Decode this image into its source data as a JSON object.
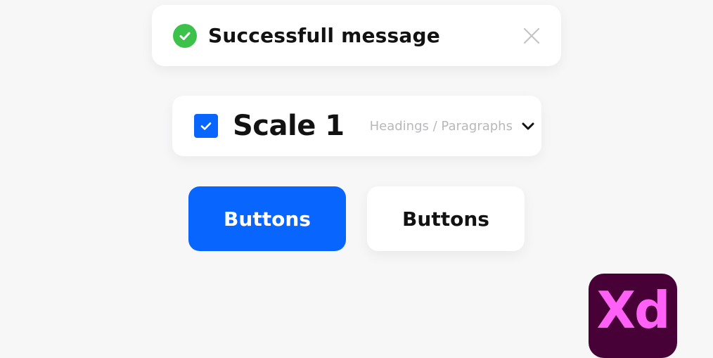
{
  "colors": {
    "success": "#3cc24a",
    "primary": "#0866ff",
    "xd_bg": "#470137",
    "xd_fg": "#ff61f6",
    "muted_text": "#b8b8bc",
    "icon_gray": "#c4c4c4"
  },
  "toast": {
    "icon": "check-circle-icon",
    "message": "Successfull message",
    "close_icon": "close-icon"
  },
  "scale_selector": {
    "checked": true,
    "checkbox_icon": "checkmark-icon",
    "title": "Scale 1",
    "subtitle": "Headings / Paragraphs",
    "dropdown_icon": "chevron-down-icon"
  },
  "buttons": {
    "primary_label": "Buttons",
    "secondary_label": "Buttons"
  },
  "logo": {
    "text": "Xd"
  }
}
